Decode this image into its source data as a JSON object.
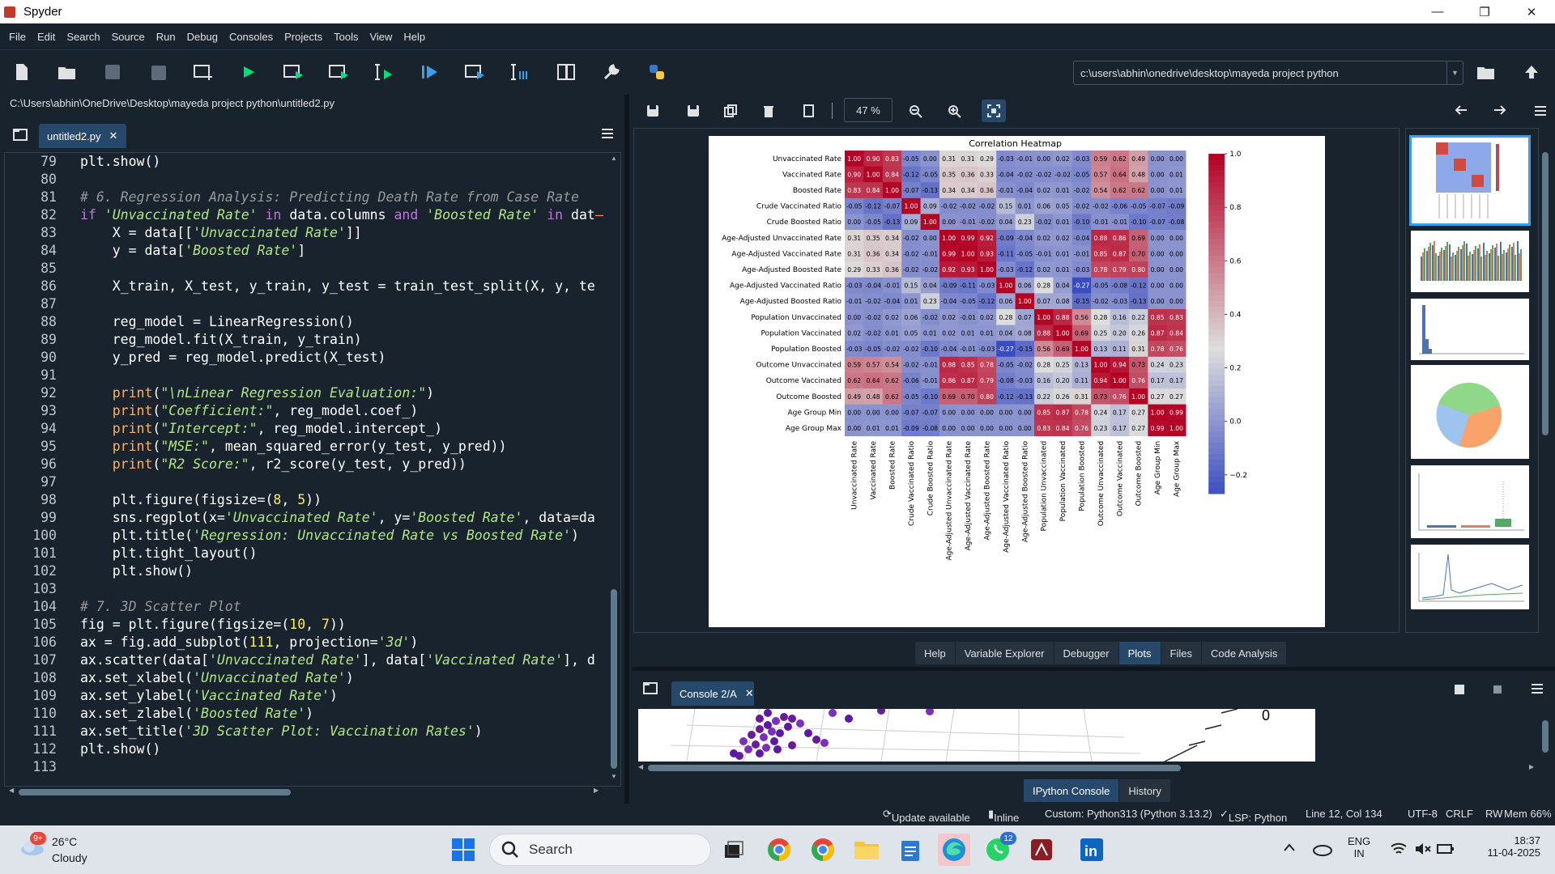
{
  "window": {
    "title": "Spyder",
    "minimize": "—",
    "maximize": "❐",
    "close": "✕"
  },
  "menu": [
    "File",
    "Edit",
    "Search",
    "Source",
    "Run",
    "Debug",
    "Consoles",
    "Projects",
    "Tools",
    "View",
    "Help"
  ],
  "toolbar": {
    "working_dir": "c:\\users\\abhin\\onedrive\\desktop\\mayeda project python"
  },
  "editor": {
    "file_path": "C:\\Users\\abhin\\OneDrive\\Desktop\\mayeda project python\\untitled2.py",
    "tab_label": "untitled2.py",
    "tab_close": "✕",
    "line_numbers": [
      "79",
      "80",
      "81",
      "82",
      "83",
      "84",
      "85",
      "86",
      "87",
      "88",
      "89",
      "90",
      "91",
      "92",
      "93",
      "94",
      "95",
      "96",
      "97",
      "98",
      "99",
      "100",
      "101",
      "102",
      "103",
      "104",
      "105",
      "106",
      "107",
      "108",
      "109",
      "110",
      "111",
      "112",
      "113"
    ],
    "lines": [
      [
        [
          "n",
          "plt.show()"
        ]
      ],
      [],
      [
        [
          "c",
          "# 6. Regression Analysis: Predicting Death Rate from Case Rate"
        ]
      ],
      [
        [
          "k",
          "if "
        ],
        [
          "s",
          "'Unvaccinated Rate'"
        ],
        [
          "k",
          " in "
        ],
        [
          "n",
          "data.columns "
        ],
        [
          "k",
          "and "
        ],
        [
          "s",
          "'Boosted Rate'"
        ],
        [
          "k",
          " in "
        ],
        [
          "n",
          "dat"
        ],
        [
          "o",
          "–"
        ]
      ],
      [
        [
          "n",
          "    X = data[["
        ],
        [
          "s",
          "'Unvaccinated Rate'"
        ],
        [
          "n",
          "]]"
        ]
      ],
      [
        [
          "n",
          "    y = data["
        ],
        [
          "s",
          "'Boosted Rate'"
        ],
        [
          "n",
          "]"
        ]
      ],
      [],
      [
        [
          "n",
          "    X_train, X_test, y_train, y_test = train_test_split(X, y, te"
        ]
      ],
      [],
      [
        [
          "n",
          "    reg_model = LinearRegression()"
        ]
      ],
      [
        [
          "n",
          "    reg_model.fit(X_train, y_train)"
        ]
      ],
      [
        [
          "n",
          "    y_pred = reg_model.predict(X_test)"
        ]
      ],
      [],
      [
        [
          "b",
          "    print"
        ],
        [
          "n",
          "("
        ],
        [
          "s",
          "\"\\nLinear Regression Evaluation:\""
        ],
        [
          "n",
          ")"
        ]
      ],
      [
        [
          "b",
          "    print"
        ],
        [
          "n",
          "("
        ],
        [
          "s",
          "\"Coefficient:\""
        ],
        [
          "n",
          ", reg_model.coef_)"
        ]
      ],
      [
        [
          "b",
          "    print"
        ],
        [
          "n",
          "("
        ],
        [
          "s",
          "\"Intercept:\""
        ],
        [
          "n",
          ", reg_model.intercept_)"
        ]
      ],
      [
        [
          "b",
          "    print"
        ],
        [
          "n",
          "("
        ],
        [
          "s",
          "\"MSE:\""
        ],
        [
          "n",
          ", mean_squared_error(y_test, y_pred))"
        ]
      ],
      [
        [
          "b",
          "    print"
        ],
        [
          "n",
          "("
        ],
        [
          "s",
          "\"R2 Score:\""
        ],
        [
          "n",
          ", r2_score(y_test, y_pred))"
        ]
      ],
      [],
      [
        [
          "n",
          "    plt.figure(figsize=("
        ],
        [
          "m",
          "8"
        ],
        [
          "n",
          ", "
        ],
        [
          "m",
          "5"
        ],
        [
          "n",
          "))"
        ]
      ],
      [
        [
          "n",
          "    sns.regplot(x="
        ],
        [
          "s",
          "'Unvaccinated Rate'"
        ],
        [
          "n",
          ", y="
        ],
        [
          "s",
          "'Boosted Rate'"
        ],
        [
          "n",
          ", data=da"
        ]
      ],
      [
        [
          "n",
          "    plt.title("
        ],
        [
          "s",
          "'Regression: Unvaccinated Rate vs Boosted Rate'"
        ],
        [
          "n",
          ")"
        ]
      ],
      [
        [
          "n",
          "    plt.tight_layout()"
        ]
      ],
      [
        [
          "n",
          "    plt.show()"
        ]
      ],
      [],
      [
        [
          "c",
          "# 7. 3D Scatter Plot"
        ]
      ],
      [
        [
          "n",
          "fig = plt.figure(figsize=("
        ],
        [
          "m",
          "10"
        ],
        [
          "n",
          ", "
        ],
        [
          "m",
          "7"
        ],
        [
          "n",
          "))"
        ]
      ],
      [
        [
          "n",
          "ax = fig.add_subplot("
        ],
        [
          "m",
          "111"
        ],
        [
          "n",
          ", projection="
        ],
        [
          "s",
          "'3d'"
        ],
        [
          "n",
          ")"
        ]
      ],
      [
        [
          "n",
          "ax.scatter(data["
        ],
        [
          "s",
          "'Unvaccinated Rate'"
        ],
        [
          "n",
          "], data["
        ],
        [
          "s",
          "'Vaccinated Rate'"
        ],
        [
          "n",
          "], d"
        ]
      ],
      [
        [
          "n",
          "ax.set_xlabel("
        ],
        [
          "s",
          "'Unvaccinated Rate'"
        ],
        [
          "n",
          ")"
        ]
      ],
      [
        [
          "n",
          "ax.set_ylabel("
        ],
        [
          "s",
          "'Vaccinated Rate'"
        ],
        [
          "n",
          ")"
        ]
      ],
      [
        [
          "n",
          "ax.set_zlabel("
        ],
        [
          "s",
          "'Boosted Rate'"
        ],
        [
          "n",
          ")"
        ]
      ],
      [
        [
          "n",
          "ax.set_title("
        ],
        [
          "s",
          "'3D Scatter Plot: Vaccination Rates'"
        ],
        [
          "n",
          ")"
        ]
      ],
      [
        [
          "n",
          "plt.show()"
        ]
      ],
      []
    ]
  },
  "plots": {
    "zoom": "47 %",
    "pane_tabs": [
      "Help",
      "Variable Explorer",
      "Debugger",
      "Plots",
      "Files",
      "Code Analysis"
    ],
    "active_tab": "Plots"
  },
  "chart_data": {
    "type": "heatmap",
    "title": "Correlation Heatmap",
    "labels": [
      "Unvaccinated Rate",
      "Vaccinated Rate",
      "Boosted Rate",
      "Crude Vaccinated Ratio",
      "Crude Boosted Ratio",
      "Age-Adjusted Unvaccinated Rate",
      "Age-Adjusted Vaccinated Rate",
      "Age-Adjusted Boosted Rate",
      "Age-Adjusted Vaccinated Ratio",
      "Age-Adjusted Boosted Ratio",
      "Population Unvaccinated",
      "Population Vaccinated",
      "Population Boosted",
      "Outcome Unvaccinated",
      "Outcome Vaccinated",
      "Outcome Boosted",
      "Age Group Min",
      "Age Group Max"
    ],
    "matrix": [
      [
        1.0,
        0.9,
        0.83,
        -0.05,
        0.0,
        0.31,
        0.31,
        0.29,
        -0.03,
        -0.01,
        0.0,
        0.02,
        -0.03,
        0.59,
        0.62,
        0.49,
        -0.0,
        -0.0
      ],
      [
        0.9,
        1.0,
        0.84,
        -0.12,
        -0.05,
        0.35,
        0.36,
        0.33,
        -0.04,
        -0.02,
        -0.02,
        -0.02,
        -0.05,
        0.57,
        0.64,
        0.48,
        -0.0,
        0.01
      ],
      [
        0.83,
        0.84,
        1.0,
        -0.07,
        -0.13,
        0.34,
        0.34,
        0.36,
        -0.01,
        -0.04,
        0.02,
        0.01,
        -0.02,
        0.54,
        0.62,
        0.62,
        0.0,
        0.01
      ],
      [
        -0.05,
        -0.12,
        -0.07,
        1.0,
        0.09,
        -0.02,
        -0.02,
        -0.02,
        0.15,
        0.01,
        0.06,
        0.05,
        -0.02,
        -0.02,
        -0.06,
        -0.05,
        -0.07,
        -0.09
      ],
      [
        0.0,
        -0.05,
        -0.13,
        0.09,
        1.0,
        0.0,
        -0.01,
        -0.02,
        0.04,
        0.23,
        -0.02,
        0.01,
        -0.1,
        -0.01,
        -0.01,
        -0.1,
        -0.07,
        -0.08
      ],
      [
        0.31,
        0.35,
        0.34,
        -0.02,
        0.0,
        1.0,
        0.99,
        0.92,
        -0.09,
        -0.04,
        0.02,
        0.02,
        -0.04,
        0.88,
        0.86,
        0.69,
        0.0,
        -0.0
      ],
      [
        0.31,
        0.36,
        0.34,
        -0.02,
        -0.01,
        0.99,
        1.0,
        0.93,
        -0.11,
        -0.05,
        -0.01,
        0.01,
        -0.01,
        0.85,
        0.87,
        0.7,
        0.0,
        -0.0
      ],
      [
        0.29,
        0.33,
        0.36,
        -0.02,
        -0.02,
        0.92,
        0.93,
        1.0,
        -0.03,
        -0.12,
        0.02,
        0.01,
        -0.03,
        0.78,
        0.79,
        0.8,
        -0.0,
        -0.0
      ],
      [
        -0.03,
        -0.04,
        -0.01,
        0.15,
        0.04,
        -0.09,
        -0.11,
        -0.03,
        1.0,
        0.06,
        0.28,
        0.04,
        -0.27,
        -0.05,
        -0.08,
        -0.12,
        0.0,
        -0.0
      ],
      [
        -0.01,
        -0.02,
        -0.04,
        0.01,
        0.23,
        -0.04,
        -0.05,
        -0.12,
        0.06,
        1.0,
        0.07,
        0.08,
        -0.15,
        -0.02,
        -0.03,
        -0.13,
        0.0,
        0.0
      ],
      [
        0.0,
        -0.02,
        0.02,
        0.06,
        -0.02,
        0.02,
        -0.01,
        0.02,
        0.28,
        0.07,
        1.0,
        0.88,
        0.56,
        0.28,
        0.16,
        0.22,
        0.85,
        0.83
      ],
      [
        0.02,
        -0.02,
        0.01,
        0.05,
        0.01,
        0.02,
        0.01,
        0.01,
        0.04,
        0.08,
        0.88,
        1.0,
        0.69,
        0.25,
        0.2,
        0.26,
        0.87,
        0.84
      ],
      [
        -0.03,
        -0.05,
        -0.02,
        -0.02,
        -0.1,
        -0.04,
        -0.01,
        -0.03,
        -0.27,
        -0.15,
        0.56,
        0.69,
        1.0,
        0.13,
        0.11,
        0.31,
        0.78,
        0.76
      ],
      [
        0.59,
        0.57,
        0.54,
        -0.02,
        -0.01,
        0.88,
        0.85,
        0.78,
        -0.05,
        -0.02,
        0.28,
        0.25,
        0.13,
        1.0,
        0.94,
        0.73,
        0.24,
        0.23
      ],
      [
        0.62,
        0.64,
        0.62,
        -0.06,
        -0.01,
        0.86,
        0.87,
        0.79,
        -0.08,
        -0.03,
        0.16,
        0.2,
        0.11,
        0.94,
        1.0,
        0.76,
        0.17,
        0.17
      ],
      [
        0.49,
        0.48,
        0.62,
        -0.05,
        -0.1,
        0.69,
        0.7,
        0.8,
        -0.12,
        -0.13,
        0.22,
        0.26,
        0.31,
        0.73,
        0.76,
        1.0,
        0.27,
        0.27
      ],
      [
        -0.0,
        -0.0,
        0.0,
        -0.07,
        -0.07,
        0.0,
        0.0,
        -0.0,
        0.0,
        0.0,
        0.85,
        0.87,
        0.78,
        0.24,
        0.17,
        0.27,
        1.0,
        0.99
      ],
      [
        -0.0,
        0.01,
        0.01,
        -0.09,
        -0.08,
        -0.0,
        -0.0,
        -0.0,
        -0.0,
        0.0,
        0.83,
        0.84,
        0.76,
        0.23,
        0.17,
        0.27,
        0.99,
        1.0
      ]
    ],
    "colorbar_ticks": [
      "1.0",
      "0.8",
      "0.6",
      "0.4",
      "0.2",
      "0.0",
      "−0.2"
    ],
    "vmin": -0.27,
    "vmax": 1.0,
    "colormap": "coolwarm"
  },
  "console": {
    "tab_label": "Console 2/A",
    "tab_close": "✕",
    "axis_label": "0",
    "bottom_tabs": [
      "IPython Console",
      "History"
    ],
    "active_tab": "IPython Console"
  },
  "status": {
    "update": "Update available",
    "inline": "Inline",
    "interpreter": "Custom: Python313 (Python 3.13.2)",
    "lsp": "LSP: Python",
    "cursor": "Line 12, Col 134",
    "encoding": "UTF-8",
    "eol": "CRLF",
    "mode": "RW",
    "mem": "Mem 66%"
  },
  "taskbar": {
    "weather_badge": "9+",
    "temperature": "26°C",
    "condition": "Cloudy",
    "search_placeholder": "Search",
    "whatsapp_badge": "12",
    "lang": "ENG",
    "region": "IN",
    "time": "18:37",
    "date": "11-04-2025"
  },
  "colors": {
    "bg": "#19232d",
    "accent": "#26486b",
    "keyword": "#c670e0",
    "string": "#b0e686",
    "comment": "#999999",
    "builtin": "#fab16c",
    "number": "#faed5c"
  }
}
